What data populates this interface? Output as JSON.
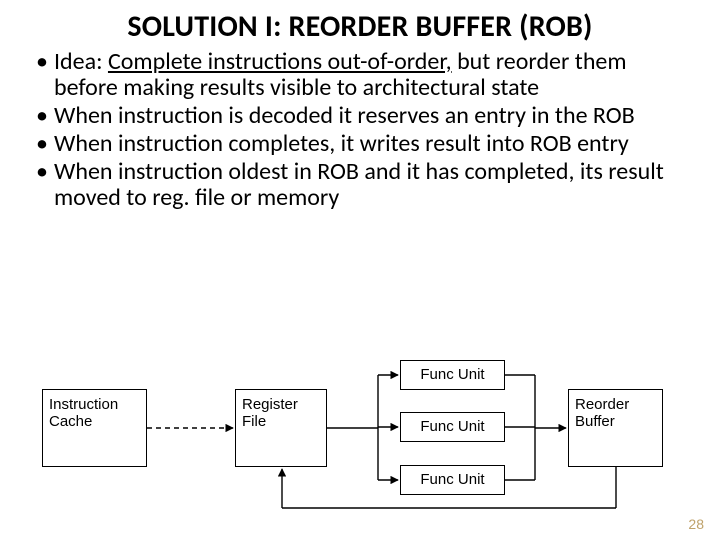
{
  "title": "SOLUTION I: REORDER BUFFER (ROB)",
  "bullets": {
    "b0_prefix": "Idea: ",
    "b0_ul": "Complete instructions out-of-order,",
    "b0_rest": " but reorder them before making results visible to architectural state",
    "b1": "When instruction is decoded it reserves an entry in the ROB",
    "b2": "When instruction completes, it writes result into ROB entry",
    "b3": "When instruction oldest in ROB and it has completed, its result moved to reg. file or memory"
  },
  "diagram": {
    "icache": "Instruction\nCache",
    "regfile": "Register\nFile",
    "fu": "Func Unit",
    "rob": "Reorder\nBuffer"
  },
  "slide_number": "28"
}
